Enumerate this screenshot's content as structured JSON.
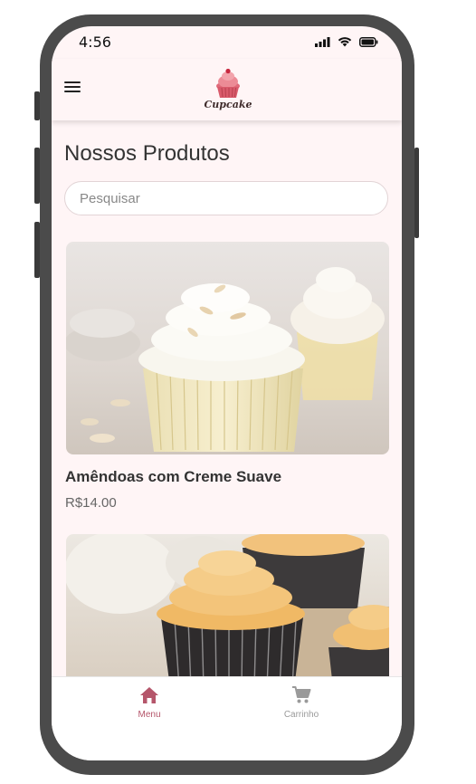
{
  "status_bar": {
    "time": "4:56"
  },
  "app_bar": {
    "logo_text": "Cupcake",
    "menu_icon": "hamburger-menu-icon"
  },
  "page": {
    "title": "Nossos Produtos"
  },
  "search": {
    "placeholder": "Pesquisar",
    "value": ""
  },
  "products": [
    {
      "name": "Amêndoas com Creme Suave",
      "price": "R$14.00",
      "image": "vanilla-cupcake-almonds"
    },
    {
      "name": "",
      "price": "",
      "image": "chocolate-cupcake-caramel-frosting"
    }
  ],
  "bottom_nav": {
    "items": [
      {
        "label": "Menu",
        "icon": "home-icon",
        "active": true
      },
      {
        "label": "Carrinho",
        "icon": "cart-icon",
        "active": false
      }
    ],
    "active_color": "#b5566b",
    "inactive_color": "#9a9a9a"
  },
  "colors": {
    "background": "#fff5f6",
    "frame": "#4b4b4b"
  }
}
